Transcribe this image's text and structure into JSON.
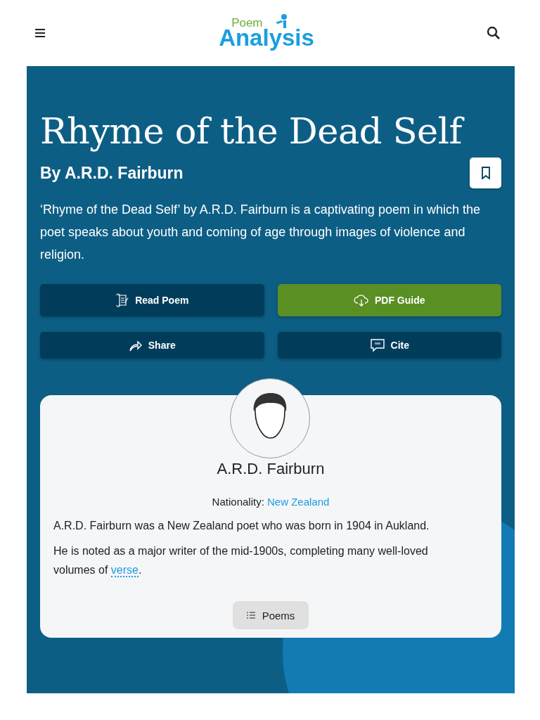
{
  "header": {
    "logo_small": "Poem",
    "logo_large": "Analysis"
  },
  "hero": {
    "title": "Rhyme of the Dead Self",
    "byline": "By A.R.D. Fairburn",
    "bookmarked": false,
    "description": "‘Rhyme of the Dead Self’ by A.R.D. Fairburn is a captivating poem in which the poet speaks about youth and coming of age through images of violence and religion.",
    "buttons": [
      {
        "label": "Read Poem",
        "kind": "read"
      },
      {
        "label": "PDF Guide",
        "kind": "pdf"
      },
      {
        "label": "Share",
        "kind": "share"
      },
      {
        "label": "Cite",
        "kind": "cite"
      }
    ]
  },
  "author": {
    "name": "A.R.D. Fairburn",
    "nationality_label": "Nationality:",
    "nationality": "New Zealand",
    "bio": [
      {
        "text": "A.R.D. Fairburn was a New Zealand poet who was born in 1904 in Aukland."
      },
      {
        "text": "He is noted as a major writer of the mid-1900s, completing many well-loved volumes of",
        "link": "verse",
        "after": "."
      }
    ],
    "button": "Poems"
  }
}
